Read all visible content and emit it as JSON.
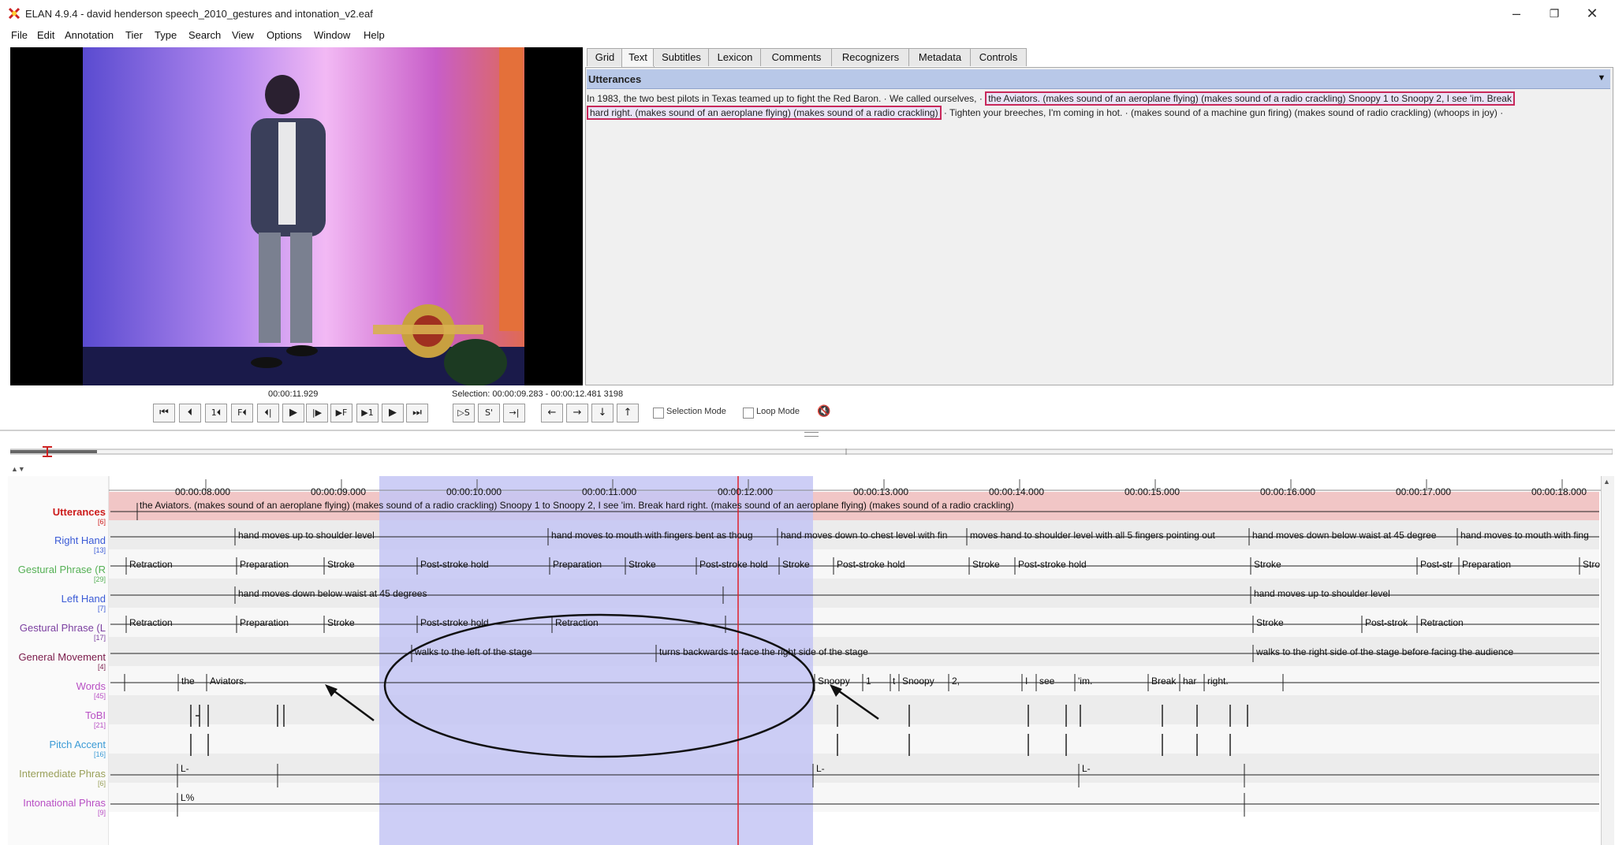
{
  "window": {
    "title": "ELAN 4.9.4 - david henderson speech_2010_gestures and intonation_v2.eaf",
    "controls": [
      "–",
      "❐",
      "✕"
    ]
  },
  "menu": [
    "File",
    "Edit",
    "Annotation",
    "Tier",
    "Type",
    "Search",
    "View",
    "Options",
    "Window",
    "Help"
  ],
  "tabs": [
    "Grid",
    "Text",
    "Subtitles",
    "Lexicon",
    "Comments",
    "Recognizers",
    "Metadata",
    "Controls"
  ],
  "active_tab": "Text",
  "text_panel": {
    "tier_label": "Utterances",
    "line1_a": "In 1983, the two best pilots in Texas teamed up to fight the Red Baron.  ·  We called ourselves,  ·",
    "line1_hl": "the Aviators. (makes sound of an aeroplane flying) (makes sound of a radio crackling) Snoopy 1 to Snoopy 2, I see 'im. Break",
    "line2_hl": "hard right. (makes sound of an aeroplane flying) (makes sound of a radio crackling)",
    "line2_b": " ·  Tighten your breeches, I'm coming in hot.  ·  (makes sound of a machine gun firing) (makes sound of radio crackling) (whoops in joy)  ·"
  },
  "player": {
    "current_time": "00:00:11.929",
    "selection": "Selection: 00:00:09.283 - 00:00:12.481  3198",
    "selection_mode": "Selection Mode",
    "loop_mode": "Loop Mode",
    "buttons": [
      "⏮",
      "⏴",
      "1⏴",
      "F⏴",
      "⏴|",
      "▶",
      "|▶",
      "▶F",
      "▶1",
      "▶",
      "⏭"
    ],
    "sel_buttons": [
      "▷S",
      "S'",
      "→|"
    ],
    "nav_buttons": [
      "←",
      "→",
      "↓",
      "↑"
    ],
    "volume_icon": "🔇"
  },
  "timeline": {
    "ticks": [
      "00:00:08.000",
      "00:00:09.000",
      "00:00:10.000",
      "00:00:11.000",
      "00:00:12.000",
      "00:00:13.000",
      "00:00:14.000",
      "00:00:15.000",
      "00:00:16.000",
      "00:00:17.000",
      "00:00:18.000"
    ],
    "tiers": [
      {
        "name": "Utterances",
        "count": "[6]",
        "color": "#cc1b1b"
      },
      {
        "name": "Right Hand",
        "count": "[13]",
        "color": "#3b5bd6"
      },
      {
        "name": "Gestural Phrase (R",
        "count": "[29]",
        "color": "#55b055"
      },
      {
        "name": "Left Hand",
        "count": "[7]",
        "color": "#3b5bd6"
      },
      {
        "name": "Gestural Phrase (L",
        "count": "[17]",
        "color": "#7b3fa0"
      },
      {
        "name": "General Movement",
        "count": "[4]",
        "color": "#7a1a4a"
      },
      {
        "name": "Words",
        "count": "[45]",
        "color": "#b84fc4"
      },
      {
        "name": "ToBI",
        "count": "[21]",
        "color": "#b84fc4"
      },
      {
        "name": "Pitch Accent",
        "count": "[16]",
        "color": "#3b9bd6"
      },
      {
        "name": "Intermediate Phras",
        "count": "[6]",
        "color": "#9aa05a"
      },
      {
        "name": "Intonational Phras",
        "count": "[9]",
        "color": "#b84fc4"
      }
    ],
    "utterance": "the Aviators. (makes sound of an aeroplane flying) (makes sound of a radio crackling) Snoopy 1 to Snoopy 2, I see 'im. Break hard right. (makes sound of an aeroplane flying) (makes sound of a radio crackling)",
    "right_hand": [
      "hand moves up to shoulder level",
      "hand moves to mouth with fingers bent as thoug",
      "hand moves down to chest level with fin",
      "moves hand to shoulder level with all 5 fingers pointing out",
      "hand moves down below waist at 45 degree",
      "hand moves to mouth with fing"
    ],
    "gp_right": [
      "Retraction",
      "Preparation",
      "Stroke",
      "Post-stroke hold",
      "Preparation",
      "Stroke",
      "Post-stroke hold",
      "Stroke",
      "Post-stroke hold",
      "Stroke",
      "Post-stroke hold",
      "Stroke",
      "Post-str",
      "Preparation",
      "Stro"
    ],
    "left_hand": [
      "hand moves down below waist at 45 degrees",
      "hand moves up to shoulder level"
    ],
    "gp_left": [
      "Retraction",
      "Preparation",
      "Stroke",
      "Post-stroke hold",
      "Retraction",
      "Stroke",
      "Post-strok",
      "Retraction"
    ],
    "general_movement": [
      "walks to the left of the stage",
      "turns backwards to face the right side of the stage",
      "walks to the right side of the stage before facing the audience"
    ],
    "words": [
      "the",
      "Aviators.",
      "Snoopy",
      "1",
      "t",
      "Snoopy",
      "2,",
      "I",
      "see",
      "'im.",
      "Break",
      "har",
      "right."
    ],
    "intermediate": [
      "L-",
      "L-",
      "L-"
    ],
    "intonational": [
      "L%"
    ]
  }
}
